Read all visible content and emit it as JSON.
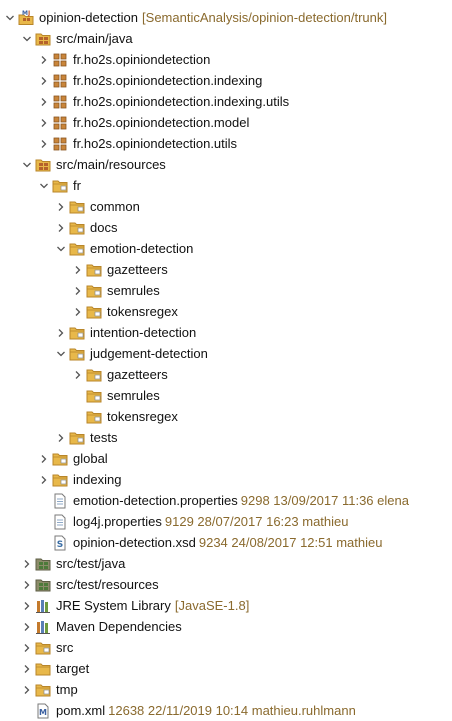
{
  "tree": {
    "rows": [
      {
        "indent": 0,
        "twisty": "down",
        "icon": "maven-project",
        "label": "opinion-detection",
        "decoration": "[SemanticAnalysis/opinion-detection/trunk]"
      },
      {
        "indent": 1,
        "twisty": "down",
        "icon": "source-folder",
        "label": "src/main/java"
      },
      {
        "indent": 2,
        "twisty": "right",
        "icon": "package",
        "label": "fr.ho2s.opiniondetection"
      },
      {
        "indent": 2,
        "twisty": "right",
        "icon": "package",
        "label": "fr.ho2s.opiniondetection.indexing"
      },
      {
        "indent": 2,
        "twisty": "right",
        "icon": "package",
        "label": "fr.ho2s.opiniondetection.indexing.utils"
      },
      {
        "indent": 2,
        "twisty": "right",
        "icon": "package",
        "label": "fr.ho2s.opiniondetection.model"
      },
      {
        "indent": 2,
        "twisty": "right",
        "icon": "package",
        "label": "fr.ho2s.opiniondetection.utils"
      },
      {
        "indent": 1,
        "twisty": "down",
        "icon": "source-folder",
        "label": "src/main/resources"
      },
      {
        "indent": 2,
        "twisty": "down",
        "icon": "folder",
        "label": "fr"
      },
      {
        "indent": 3,
        "twisty": "right",
        "icon": "folder",
        "label": "common"
      },
      {
        "indent": 3,
        "twisty": "right",
        "icon": "folder",
        "label": "docs"
      },
      {
        "indent": 3,
        "twisty": "down",
        "icon": "folder",
        "label": "emotion-detection"
      },
      {
        "indent": 4,
        "twisty": "right",
        "icon": "folder",
        "label": "gazetteers"
      },
      {
        "indent": 4,
        "twisty": "right",
        "icon": "folder",
        "label": "semrules"
      },
      {
        "indent": 4,
        "twisty": "right",
        "icon": "folder",
        "label": "tokensregex"
      },
      {
        "indent": 3,
        "twisty": "right",
        "icon": "folder",
        "label": "intention-detection"
      },
      {
        "indent": 3,
        "twisty": "down",
        "icon": "folder",
        "label": "judgement-detection"
      },
      {
        "indent": 4,
        "twisty": "right",
        "icon": "folder",
        "label": "gazetteers"
      },
      {
        "indent": 4,
        "twisty": "none",
        "icon": "folder",
        "label": "semrules"
      },
      {
        "indent": 4,
        "twisty": "none",
        "icon": "folder",
        "label": "tokensregex"
      },
      {
        "indent": 3,
        "twisty": "right",
        "icon": "folder",
        "label": "tests"
      },
      {
        "indent": 2,
        "twisty": "right",
        "icon": "folder",
        "label": "global"
      },
      {
        "indent": 2,
        "twisty": "right",
        "icon": "folder",
        "label": "indexing"
      },
      {
        "indent": 2,
        "twisty": "none",
        "icon": "properties-file",
        "label": "emotion-detection.properties",
        "meta": "9298  13/09/2017 11:36  elena"
      },
      {
        "indent": 2,
        "twisty": "none",
        "icon": "properties-file",
        "label": "log4j.properties",
        "meta": "9129  28/07/2017 16:23  mathieu"
      },
      {
        "indent": 2,
        "twisty": "none",
        "icon": "xsd-file",
        "label": "opinion-detection.xsd",
        "meta": "9234  24/08/2017 12:51  mathieu"
      },
      {
        "indent": 1,
        "twisty": "right",
        "icon": "test-source-folder",
        "label": "src/test/java"
      },
      {
        "indent": 1,
        "twisty": "right",
        "icon": "test-source-folder",
        "label": "src/test/resources"
      },
      {
        "indent": 1,
        "twisty": "right",
        "icon": "library",
        "label": "JRE System Library",
        "decoration": "[JavaSE-1.8]"
      },
      {
        "indent": 1,
        "twisty": "right",
        "icon": "library",
        "label": "Maven Dependencies"
      },
      {
        "indent": 1,
        "twisty": "right",
        "icon": "folder",
        "label": "src"
      },
      {
        "indent": 1,
        "twisty": "right",
        "icon": "plain-folder",
        "label": "target"
      },
      {
        "indent": 1,
        "twisty": "right",
        "icon": "folder",
        "label": "tmp"
      },
      {
        "indent": 1,
        "twisty": "none",
        "icon": "maven-pom-file",
        "label": "pom.xml",
        "meta": "12638  22/11/2019 10:14  mathieu.ruhlmann"
      }
    ]
  },
  "colors": {
    "folder": "#e8b84a",
    "folder_dark": "#b8862a",
    "package": "#c9853a",
    "decoration": "#8a6a2e",
    "twisty": "#555555"
  }
}
